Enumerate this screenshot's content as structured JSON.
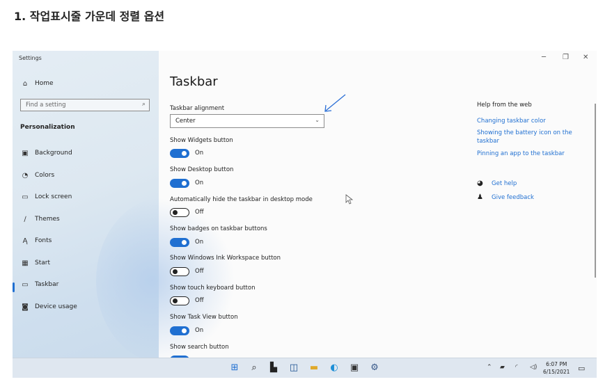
{
  "heading": "1. 작업표시줄 가운데 정렬 옵션",
  "window": {
    "title": "Settings"
  },
  "sidebar": {
    "home": "Home",
    "search_placeholder": "Find a setting",
    "section": "Personalization",
    "items": [
      {
        "label": "Background",
        "icon": "background-icon"
      },
      {
        "label": "Colors",
        "icon": "palette-icon"
      },
      {
        "label": "Lock screen",
        "icon": "lock-screen-icon"
      },
      {
        "label": "Themes",
        "icon": "brush-icon"
      },
      {
        "label": "Fonts",
        "icon": "fonts-icon"
      },
      {
        "label": "Start",
        "icon": "start-icon"
      },
      {
        "label": "Taskbar",
        "icon": "taskbar-icon",
        "selected": true
      },
      {
        "label": "Device usage",
        "icon": "device-usage-icon"
      }
    ]
  },
  "main": {
    "title": "Taskbar",
    "alignment_label": "Taskbar alignment",
    "alignment_value": "Center",
    "settings": [
      {
        "label": "Show Widgets button",
        "state": "On"
      },
      {
        "label": "Show Desktop button",
        "state": "On"
      },
      {
        "label": "Automatically hide the taskbar in desktop mode",
        "state": "Off"
      },
      {
        "label": "Show badges on taskbar buttons",
        "state": "On"
      },
      {
        "label": "Show Windows Ink Workspace button",
        "state": "Off"
      },
      {
        "label": "Show touch keyboard button",
        "state": "Off"
      },
      {
        "label": "Show Task View button",
        "state": "On"
      },
      {
        "label": "Show search button",
        "state": ""
      }
    ]
  },
  "help": {
    "heading": "Help from the web",
    "links": [
      "Changing taskbar color",
      "Showing the battery icon on the taskbar",
      "Pinning an app to the taskbar"
    ],
    "get_help": "Get help",
    "give_feedback": "Give feedback"
  },
  "taskbar": {
    "time": "6:07 PM",
    "date": "6/15/2021",
    "accent": "#1f6fd1"
  }
}
